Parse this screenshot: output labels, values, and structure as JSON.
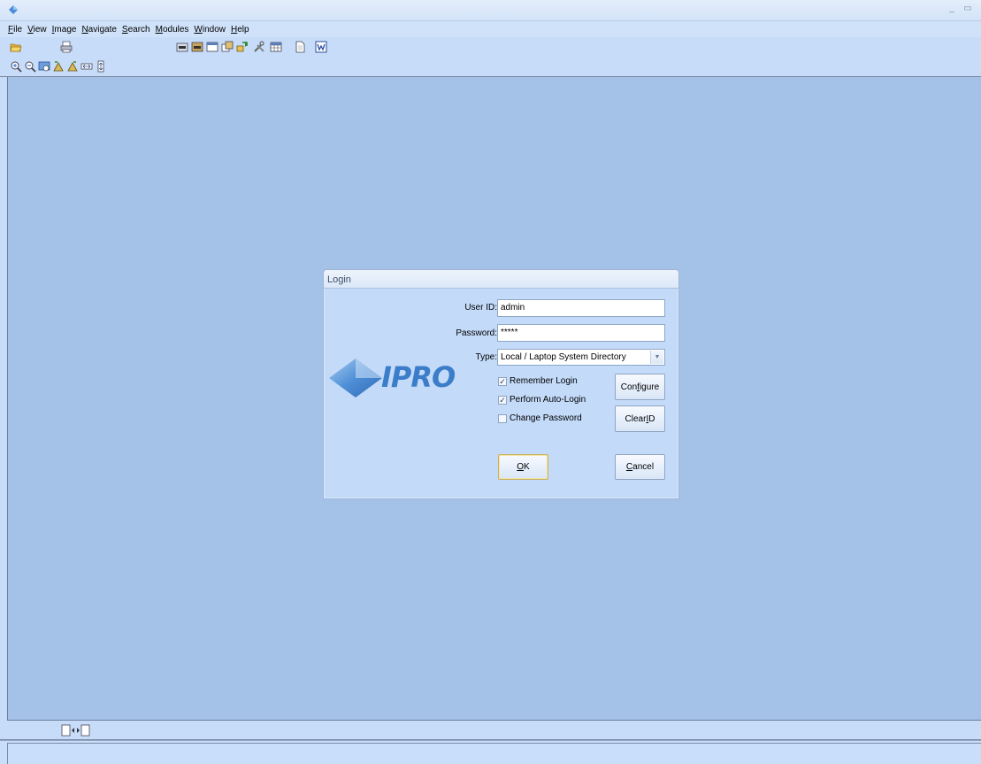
{
  "window": {
    "minimize_glyph": "_",
    "restore_glyph": "▭"
  },
  "menu": [
    {
      "accel": "F",
      "rest": "ile"
    },
    {
      "accel": "V",
      "rest": "iew"
    },
    {
      "accel": "I",
      "rest": "mage"
    },
    {
      "accel": "N",
      "rest": "avigate"
    },
    {
      "accel": "S",
      "rest": "earch"
    },
    {
      "accel": "M",
      "rest": "odules"
    },
    {
      "accel": "W",
      "rest": "indow"
    },
    {
      "accel": "H",
      "rest": "elp"
    }
  ],
  "toolbar_icons": {
    "primary": [
      "open-folder-icon",
      "print-icon",
      "ocr-icon",
      "ocr-batch-icon",
      "window-icon",
      "export-icon",
      "transfer-icon",
      "tools-icon",
      "grid-icon",
      "document-icon",
      "word-icon"
    ],
    "secondary": [
      "zoom-in-icon",
      "zoom-out-icon",
      "fit-page-icon",
      "rotate-left-icon",
      "rotate-right-icon",
      "fit-width-icon",
      "fit-height-icon"
    ]
  },
  "dialog": {
    "title": "Login",
    "user_id_label": "User ID:",
    "user_id_value": "admin",
    "password_label": "Password:",
    "password_value": "*****",
    "type_label": "Type:",
    "type_value": "Local / Laptop System Directory",
    "logo_text": "IPRO",
    "remember_login": {
      "label": "Remember Login",
      "checked": true
    },
    "perform_auto_login": {
      "label": "Perform Auto-Login",
      "checked": true
    },
    "change_password": {
      "label": "Change Password",
      "checked": false
    },
    "configure": {
      "pre": "Con",
      "accel": "f",
      "post": "igure"
    },
    "clear_id": {
      "pre": "Clear ",
      "accel": "I",
      "post": "D"
    },
    "ok": {
      "pre": "",
      "accel": "O",
      "post": "K"
    },
    "cancel": {
      "pre": "",
      "accel": "C",
      "post": "ancel"
    }
  },
  "colors": {
    "workspace": "#a4c2e8",
    "chrome": "#c7dcf8",
    "logo_blue": "#3b7dc9"
  }
}
